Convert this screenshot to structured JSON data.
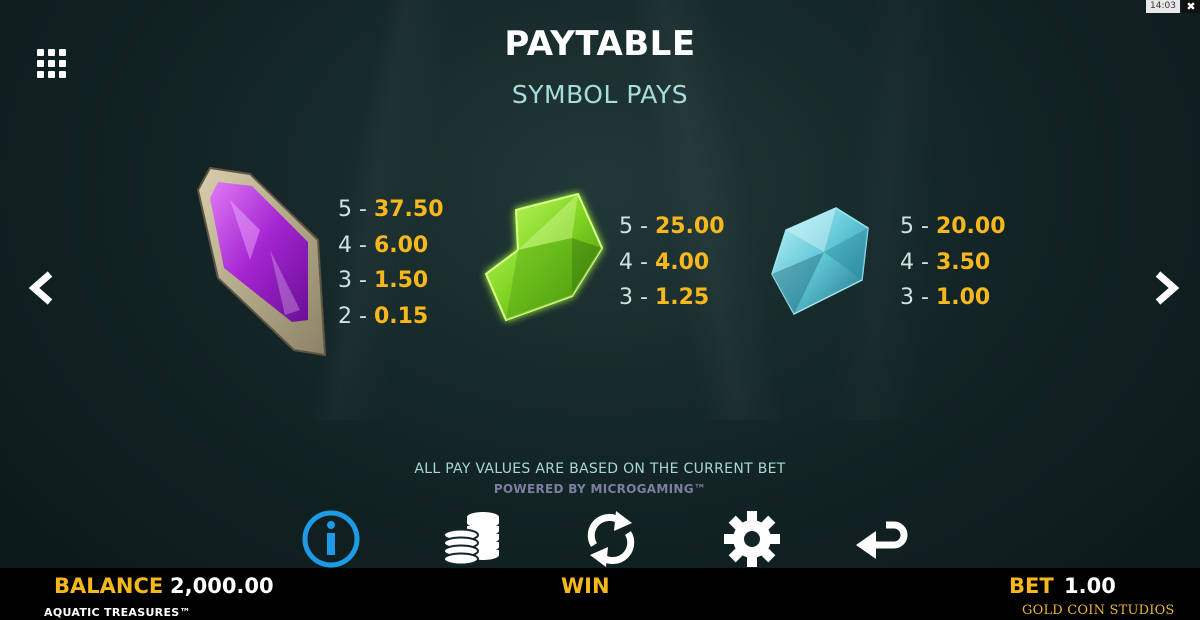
{
  "system": {
    "time": "14:03",
    "close_glyph": "✖"
  },
  "header": {
    "title": "PAYTABLE",
    "subtitle": "SYMBOL PAYS"
  },
  "menu": {
    "icon": "menu-grid-icon"
  },
  "navigation": {
    "prev_icon": "chevron-left-icon",
    "next_icon": "chevron-right-icon"
  },
  "symbols": [
    {
      "name": "purple-gem",
      "color": "#b02fd8",
      "pays": [
        {
          "count": "5 -",
          "value": "37.50"
        },
        {
          "count": "4 -",
          "value": "6.00"
        },
        {
          "count": "3 -",
          "value": "1.50"
        },
        {
          "count": "2 -",
          "value": "0.15"
        }
      ]
    },
    {
      "name": "green-gem",
      "color": "#7ed321",
      "pays": [
        {
          "count": "5 -",
          "value": "25.00"
        },
        {
          "count": "4 -",
          "value": "4.00"
        },
        {
          "count": "3 -",
          "value": "1.25"
        }
      ]
    },
    {
      "name": "blue-gem",
      "color": "#5fc6d6",
      "pays": [
        {
          "count": "5 -",
          "value": "20.00"
        },
        {
          "count": "4 -",
          "value": "3.50"
        },
        {
          "count": "3 -",
          "value": "1.00"
        }
      ]
    }
  ],
  "footer_note": "ALL PAY VALUES ARE BASED ON THE CURRENT BET",
  "powered_by": "POWERED BY MICROGAMING™",
  "controls": [
    {
      "name": "info-button",
      "icon": "info-icon",
      "active": true
    },
    {
      "name": "bet-coins-button",
      "icon": "coins-icon",
      "active": false
    },
    {
      "name": "autoplay-button",
      "icon": "refresh-icon",
      "active": false
    },
    {
      "name": "settings-button",
      "icon": "gear-icon",
      "active": false
    },
    {
      "name": "back-button",
      "icon": "return-arrow-icon",
      "active": false
    }
  ],
  "status_bar": {
    "balance_label": "BALANCE",
    "balance_value": "2,000.00",
    "win_label": "WIN",
    "bet_label": "BET",
    "bet_value": "1.00"
  },
  "branding": {
    "game_name": "AQUATIC TREASURES™",
    "studio": "GOLD COIN STUDIOS"
  },
  "colors": {
    "accent_gold": "#f7b81d",
    "subtitle_teal": "#a7ddda",
    "info_blue": "#1e9be6"
  }
}
